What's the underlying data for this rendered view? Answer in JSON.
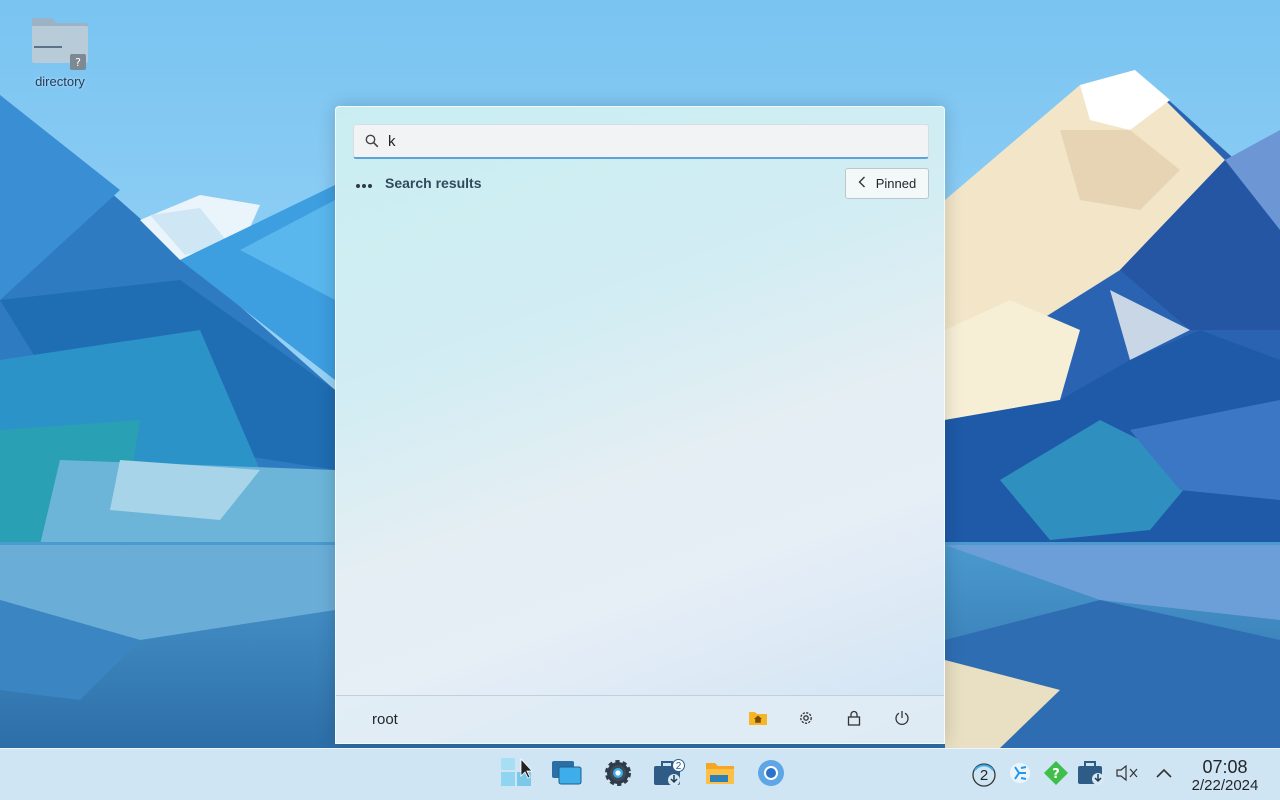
{
  "desktop": {
    "icons": [
      {
        "label": "directory",
        "icon": "folder-unknown-icon"
      }
    ]
  },
  "launcher": {
    "search": {
      "value": "k",
      "placeholder": ""
    },
    "results_header": {
      "title": "Search results",
      "icon": "more-dots-icon"
    },
    "pinned_button": {
      "label": "Pinned",
      "icon": "chevron-left-icon"
    },
    "footer": {
      "user": "root",
      "actions": [
        {
          "name": "home-folder",
          "icon": "home-folder-icon"
        },
        {
          "name": "settings",
          "icon": "gear-icon"
        },
        {
          "name": "lock",
          "icon": "lock-icon"
        },
        {
          "name": "power",
          "icon": "power-icon"
        }
      ]
    }
  },
  "taskbar": {
    "apps": [
      {
        "name": "start-menu",
        "icon": "windows-logo-icon"
      },
      {
        "name": "task-view",
        "icon": "overlapping-windows-icon"
      },
      {
        "name": "system-settings",
        "icon": "gear-icon"
      },
      {
        "name": "software-updater",
        "icon": "briefcase-download-icon",
        "badge": "2"
      },
      {
        "name": "file-manager",
        "icon": "folder-icon"
      },
      {
        "name": "chromium",
        "icon": "chromium-icon"
      }
    ],
    "tray": [
      {
        "name": "updates-count",
        "icon": "circled-number-icon",
        "text": "2"
      },
      {
        "name": "kde-connect",
        "icon": "kde-icon"
      },
      {
        "name": "help",
        "icon": "question-diamond-icon"
      },
      {
        "name": "downloads",
        "icon": "briefcase-download-icon"
      },
      {
        "name": "volume-muted",
        "icon": "speaker-muted-icon"
      },
      {
        "name": "show-hidden",
        "icon": "chevron-up-icon"
      }
    ],
    "clock": {
      "time": "07:08",
      "date": "2/22/2024"
    }
  },
  "colors": {
    "accent": "#3daee9",
    "taskbar_bg": "#d6e8f4",
    "home_folder": "#f5b625"
  }
}
